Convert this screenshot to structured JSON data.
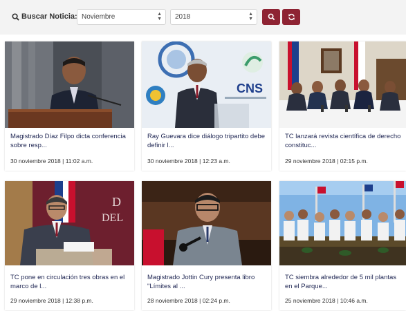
{
  "filter": {
    "label": "Buscar Noticia:",
    "month": "Noviembre",
    "year": "2018"
  },
  "cards": [
    {
      "title": "Magistrado Díaz Filpo dicta conferencia sobre resp...",
      "date": "30 noviembre 2018 | 11:02 a.m."
    },
    {
      "title": "Ray Guevara dice diálogo tripartito debe definir l...",
      "date": "30 noviembre 2018 | 12:23 a.m."
    },
    {
      "title": "TC lanzará revista científica de derecho constituc...",
      "date": "29 noviembre 2018 | 02:15 p.m."
    },
    {
      "title": "TC pone en circulación tres obras en el marco de l...",
      "date": "29 noviembre 2018 | 12:38 p.m."
    },
    {
      "title": "Magistrado Jottin Cury presenta libro \"Límites al ...",
      "date": "28 noviembre 2018 | 02:24 p.m."
    },
    {
      "title": "TC siembra alrededor de 5 mil plantas en el Parque...",
      "date": "25 noviembre 2018 | 10:46 a.m."
    }
  ],
  "photo_text": {
    "cns_logo": "CNS",
    "banner_letters": "D\nDEL"
  },
  "colors": {
    "accent": "#8e2333",
    "title_text": "#232a56",
    "filter_bg": "#f3f3f3"
  }
}
